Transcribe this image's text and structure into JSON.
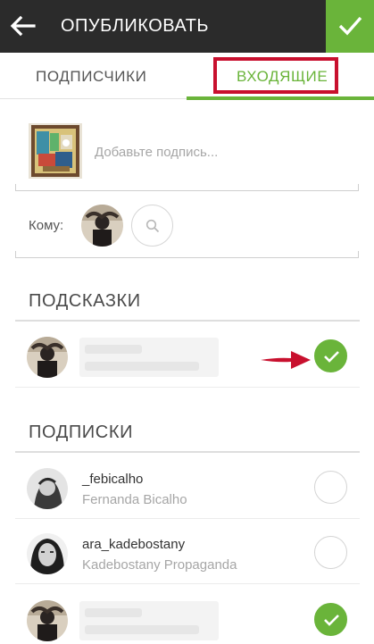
{
  "header": {
    "title": "ОПУБЛИКОВАТЬ",
    "back_icon": "arrow-left-icon",
    "confirm_icon": "checkmark-icon"
  },
  "tabs": [
    {
      "label": "ПОДПИСЧИКИ",
      "active": false
    },
    {
      "label": "ВХОДЯЩИЕ",
      "active": true
    }
  ],
  "compose": {
    "caption_placeholder": "Добавьте подпись...",
    "to_label": "Кому:"
  },
  "sections": {
    "suggestions": {
      "title": "ПОДСКАЗКИ",
      "items": [
        {
          "username": "",
          "full_name": "",
          "obscured": true,
          "selected": true
        }
      ]
    },
    "following": {
      "title": "ПОДПИСКИ",
      "items": [
        {
          "username": "_febicalho",
          "full_name": "Fernanda Bicalho",
          "selected": false
        },
        {
          "username": "ara_kadebostany",
          "full_name": "Kadebostany Propaganda",
          "selected": false
        },
        {
          "username": "",
          "full_name": "",
          "obscured": true,
          "selected": true
        }
      ]
    }
  },
  "colors": {
    "accent": "#6ab43a",
    "topbar": "#2b2b2b",
    "annotation": "#c8102e"
  }
}
